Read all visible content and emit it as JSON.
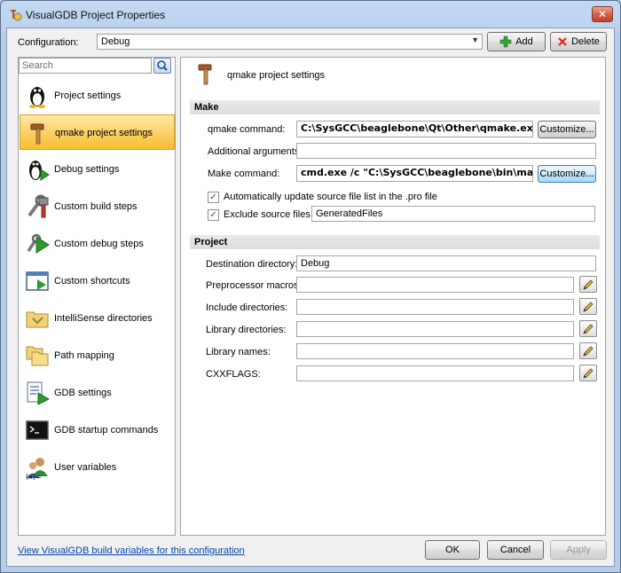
{
  "window": {
    "title": "VisualGDB Project Properties",
    "close_glyph": "✕"
  },
  "config": {
    "label": "Configuration:",
    "value": "Debug",
    "add_label": "Add",
    "delete_label": "Delete"
  },
  "search": {
    "placeholder": "Search"
  },
  "nav": [
    {
      "label": "Project settings",
      "icon": "linux-penguin-icon"
    },
    {
      "label": "qmake project settings",
      "icon": "hammer-icon",
      "selected": true
    },
    {
      "label": "Debug settings",
      "icon": "debug-penguin-icon"
    },
    {
      "label": "Custom build steps",
      "icon": "tools-icon"
    },
    {
      "label": "Custom debug steps",
      "icon": "debug-step-icon"
    },
    {
      "label": "Custom shortcuts",
      "icon": "window-shortcut-icon"
    },
    {
      "label": "IntelliSense directories",
      "icon": "folder-icon"
    },
    {
      "label": "Path mapping",
      "icon": "folders-icon"
    },
    {
      "label": "GDB settings",
      "icon": "document-play-icon"
    },
    {
      "label": "GDB startup commands",
      "icon": "console-icon"
    },
    {
      "label": "User variables",
      "icon": "users-variable-icon"
    }
  ],
  "page": {
    "title": "qmake project settings"
  },
  "make": {
    "heading": "Make",
    "qmake_label": "qmake command:",
    "qmake_value": "C:\\SysGCC\\beaglebone\\Qt\\Other\\qmake.exe",
    "customize_label": "Customize...",
    "args_label": "Additional arguments:",
    "args_value": "",
    "make_label": "Make command:",
    "make_value": "cmd.exe /c \"C:\\SysGCC\\beaglebone\\bin\\make.exe\"",
    "auto_update_label": "Automatically update source file list in the .pro file",
    "auto_update_checked": true,
    "exclude_label": "Exclude source files in",
    "exclude_checked": true,
    "exclude_value": "GeneratedFiles",
    "check_glyph": "✓"
  },
  "project": {
    "heading": "Project",
    "dest_label": "Destination directory:",
    "dest_value": "Debug",
    "preproc_label": "Preprocessor macros:",
    "preproc_value": "",
    "include_label": "Include directories:",
    "include_value": "",
    "libdir_label": "Library directories:",
    "libdir_value": "",
    "libnames_label": "Library names:",
    "libnames_value": "",
    "cxxflags_label": "CXXFLAGS:",
    "cxxflags_value": ""
  },
  "footer": {
    "link": "View VisualGDB build variables for this configuration",
    "ok": "OK",
    "cancel": "Cancel",
    "apply": "Apply"
  },
  "colors": {
    "selection": "#f7bd2e",
    "link": "#0645ad",
    "title_bg": "#bcd3ef",
    "close_button": "#c2412a"
  }
}
